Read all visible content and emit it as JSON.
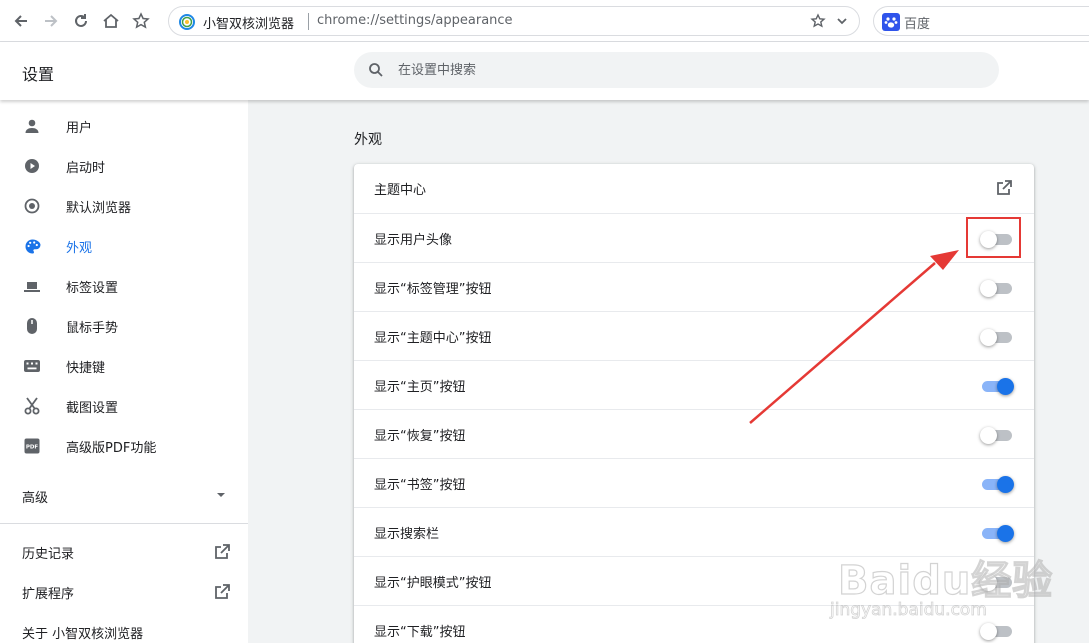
{
  "browser": {
    "app_name": "小智双核浏览器",
    "url": "chrome://settings/appearance",
    "search_engine": "百度"
  },
  "settings": {
    "title": "设置",
    "search_placeholder": "在设置中搜索"
  },
  "sidebar": {
    "items": [
      {
        "label": "用户",
        "icon": "person-icon"
      },
      {
        "label": "启动时",
        "icon": "power-icon"
      },
      {
        "label": "默认浏览器",
        "icon": "browser-icon"
      },
      {
        "label": "外观",
        "icon": "palette-icon",
        "active": true
      },
      {
        "label": "标签设置",
        "icon": "tab-icon"
      },
      {
        "label": "鼠标手势",
        "icon": "mouse-icon"
      },
      {
        "label": "快捷键",
        "icon": "keyboard-icon"
      },
      {
        "label": "截图设置",
        "icon": "scissors-icon"
      },
      {
        "label": "高级版PDF功能",
        "icon": "pdf-icon"
      }
    ],
    "advanced": "高级",
    "history": "历史记录",
    "extensions": "扩展程序",
    "about": "关于 小智双核浏览器"
  },
  "appearance": {
    "section_title": "外观",
    "rows": [
      {
        "label": "主题中心",
        "type": "link"
      },
      {
        "label": "显示用户头像",
        "type": "toggle",
        "on": false
      },
      {
        "label": "显示“标签管理”按钮",
        "type": "toggle",
        "on": false
      },
      {
        "label": "显示“主题中心”按钮",
        "type": "toggle",
        "on": false
      },
      {
        "label": "显示“主页”按钮",
        "type": "toggle",
        "on": true
      },
      {
        "label": "显示“恢复”按钮",
        "type": "toggle",
        "on": false
      },
      {
        "label": "显示“书签”按钮",
        "type": "toggle",
        "on": true
      },
      {
        "label": "显示搜索栏",
        "type": "toggle",
        "on": true
      },
      {
        "label": "显示“护眼模式”按钮",
        "type": "toggle",
        "on": false
      },
      {
        "label": "显示“下载”按钮",
        "type": "toggle",
        "on": false
      }
    ]
  },
  "watermark": {
    "main": "Baidu经验",
    "sub": "jingyan.baidu.com"
  },
  "colors": {
    "accent": "#1a73e8",
    "annotation": "#e53935"
  }
}
